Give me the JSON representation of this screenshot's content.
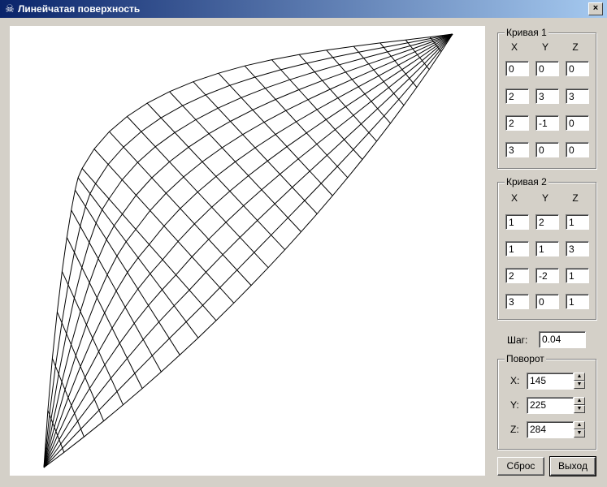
{
  "window": {
    "title": "Линейчатая поверхность",
    "close_label": "×"
  },
  "curve1": {
    "label": "Кривая 1",
    "headers": [
      "X",
      "Y",
      "Z"
    ],
    "rows": [
      [
        "0",
        "0",
        "0"
      ],
      [
        "2",
        "3",
        "3"
      ],
      [
        "2",
        "-1",
        "0"
      ],
      [
        "3",
        "0",
        "0"
      ]
    ]
  },
  "curve2": {
    "label": "Кривая 2",
    "headers": [
      "X",
      "Y",
      "Z"
    ],
    "rows": [
      [
        "1",
        "2",
        "1"
      ],
      [
        "1",
        "1",
        "3"
      ],
      [
        "2",
        "-2",
        "1"
      ],
      [
        "3",
        "0",
        "1"
      ]
    ]
  },
  "step": {
    "label": "Шаг:",
    "value": "0.04"
  },
  "rotation": {
    "label": "Поворот",
    "x_label": "X:",
    "x_value": "145",
    "y_label": "Y:",
    "y_value": "225",
    "z_label": "Z:",
    "z_value": "284"
  },
  "buttons": {
    "reset": "Сброс",
    "exit": "Выход"
  },
  "icons": {
    "app": "skull-icon",
    "spin_up": "up-arrow-icon",
    "spin_down": "down-arrow-icon"
  }
}
